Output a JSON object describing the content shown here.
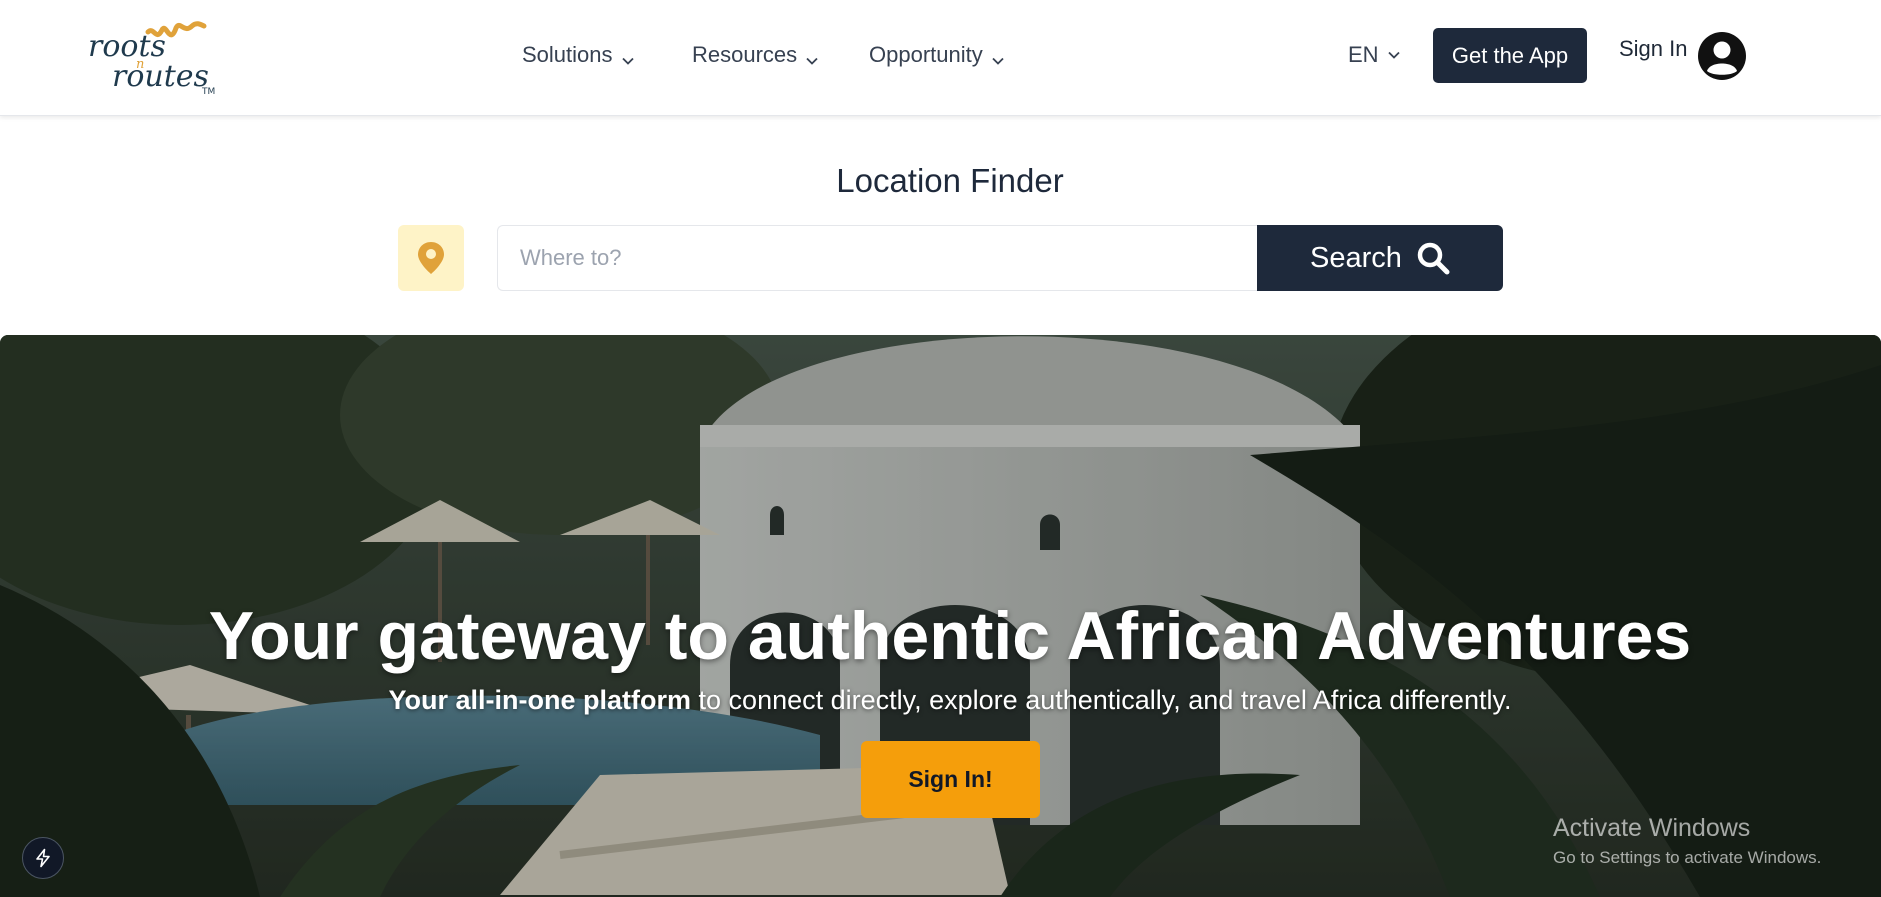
{
  "header": {
    "logo": {
      "word1": "roots",
      "word2": "n",
      "word3": "routes",
      "trademark": "TM",
      "colors": {
        "text": "#1f3a4d",
        "accent": "#e0a23a"
      }
    },
    "nav": [
      {
        "label": "Solutions",
        "icon": "chevron-down-icon"
      },
      {
        "label": "Resources",
        "icon": "chevron-down-icon"
      },
      {
        "label": "Opportunity",
        "icon": "chevron-down-icon"
      }
    ],
    "language": {
      "value": "EN",
      "icon": "chevron-down-icon"
    },
    "get_app_label": "Get the App",
    "sign_in_label": "Sign In",
    "avatar_icon": "user-circle-icon"
  },
  "finder": {
    "title": "Location Finder",
    "pin_icon": "map-pin-icon",
    "search": {
      "placeholder": "Where to?",
      "value": ""
    },
    "search_button_label": "Search",
    "search_icon": "magnifier-icon"
  },
  "hero": {
    "title": "Your gateway to authentic African Adventures",
    "subtitle_bold": "Your all-in-one platform",
    "subtitle_rest": " to connect directly, explore authentically, and travel Africa differently.",
    "sign_in_button_label": "Sign In!",
    "bolt_icon": "lightning-bolt-icon"
  },
  "watermark": {
    "title": "Activate Windows",
    "subtitle": "Go to Settings to activate Windows."
  },
  "colors": {
    "primary": "#1e293b",
    "accent": "#f59e0b",
    "pin": "#e0a23a",
    "pin_background": "#fef3c7"
  }
}
